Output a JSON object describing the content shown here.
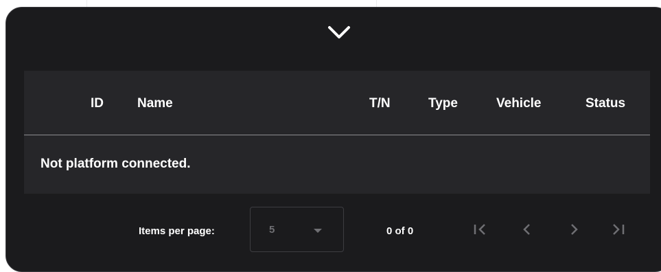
{
  "colors": {
    "panel_bg": "#1b1b1d",
    "table_bg": "#262629",
    "text": "#ffffff",
    "muted": "#6f6f73",
    "divider": "#8d8d91"
  },
  "header": {
    "collapse_icon": "chevron-down-icon"
  },
  "table": {
    "columns": [
      {
        "key": "id",
        "label": "ID"
      },
      {
        "key": "name",
        "label": "Name"
      },
      {
        "key": "tn",
        "label": "T/N"
      },
      {
        "key": "type",
        "label": "Type"
      },
      {
        "key": "vehicle",
        "label": "Vehicle"
      },
      {
        "key": "status",
        "label": "Status"
      }
    ],
    "empty_message": "Not platform connected."
  },
  "paginator": {
    "items_per_page_label": "Items per page:",
    "items_per_page_value": "5",
    "range_label": "0 of 0",
    "icons": [
      "first-page-icon",
      "previous-page-icon",
      "next-page-icon",
      "last-page-icon"
    ]
  }
}
